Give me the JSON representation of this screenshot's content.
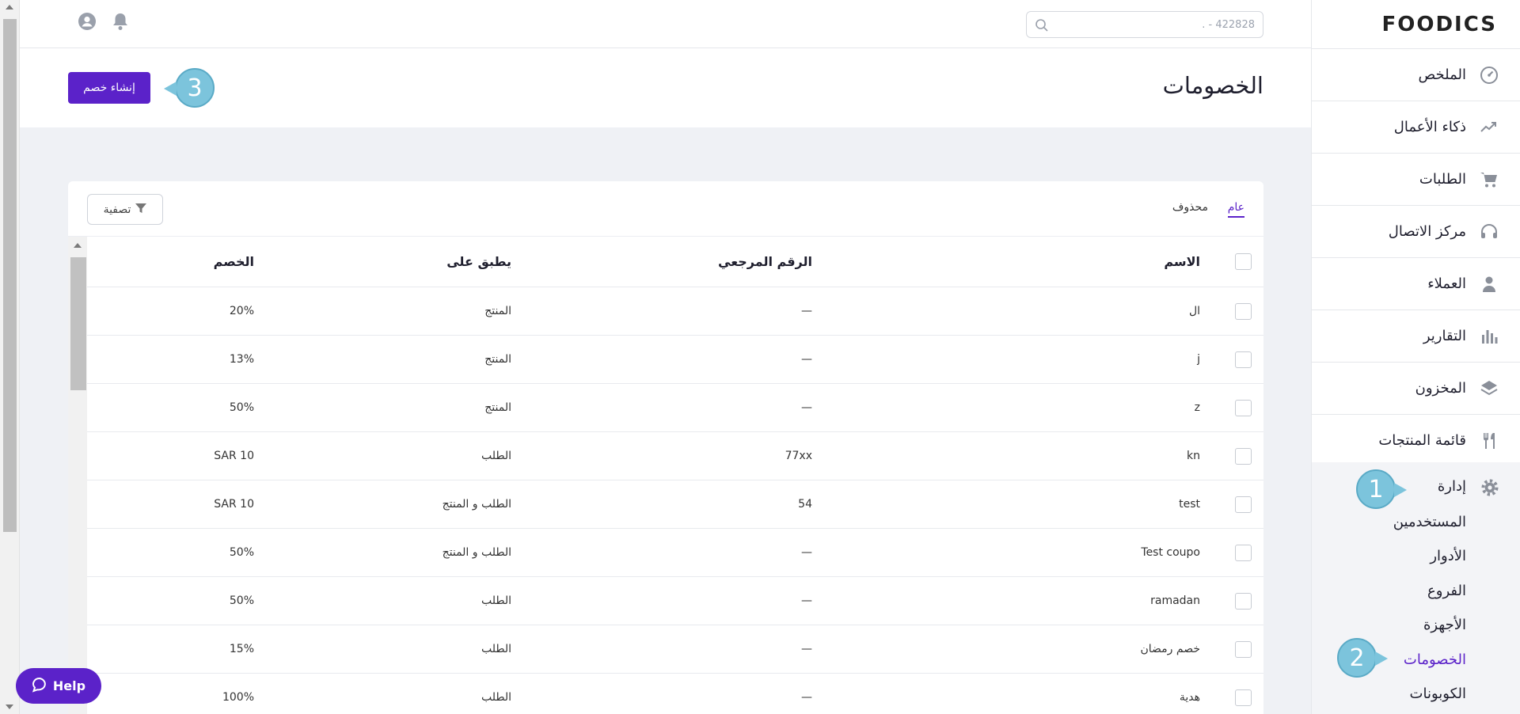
{
  "topbar": {
    "search_placeholder": "422828 - .",
    "icons": [
      "profile-icon",
      "bell-icon",
      "search-icon"
    ]
  },
  "header": {
    "title": "الخصومات",
    "create_button": "إنشاء خصم"
  },
  "tabs": {
    "general": "عام",
    "deleted": "محذوف",
    "filter": "تصفية"
  },
  "table": {
    "headers": {
      "name": "الاسم",
      "reference": "الرقم المرجعي",
      "applies_to": "يطبق على",
      "discount": "الخصم"
    },
    "rows": [
      {
        "name": "ال",
        "reference": "—",
        "applies_to": "المنتج",
        "discount": "20%"
      },
      {
        "name": "j",
        "reference": "—",
        "applies_to": "المنتج",
        "discount": "13%"
      },
      {
        "name": "z",
        "reference": "—",
        "applies_to": "المنتج",
        "discount": "50%"
      },
      {
        "name": "kn",
        "reference": "77xx",
        "applies_to": "الطلب",
        "discount": "SAR 10"
      },
      {
        "name": "test",
        "reference": "54",
        "applies_to": "الطلب و المنتج",
        "discount": "SAR 10"
      },
      {
        "name": "Test coupo",
        "reference": "—",
        "applies_to": "الطلب و المنتج",
        "discount": "50%"
      },
      {
        "name": "ramadan",
        "reference": "—",
        "applies_to": "الطلب",
        "discount": "50%"
      },
      {
        "name": "خصم رمضان",
        "reference": "—",
        "applies_to": "الطلب",
        "discount": "15%"
      },
      {
        "name": "هدية",
        "reference": "—",
        "applies_to": "الطلب",
        "discount": "100%"
      }
    ]
  },
  "sidebar": {
    "logo": "FOODICS",
    "items": [
      {
        "label": "الملخص",
        "icon": "dashboard-icon"
      },
      {
        "label": "ذكاء الأعمال",
        "icon": "chart-line-icon"
      },
      {
        "label": "الطلبات",
        "icon": "cart-icon"
      },
      {
        "label": "مركز الاتصال",
        "icon": "headset-icon"
      },
      {
        "label": "العملاء",
        "icon": "customers-icon"
      },
      {
        "label": "التقارير",
        "icon": "bar-chart-icon"
      },
      {
        "label": "المخزون",
        "icon": "layers-icon"
      },
      {
        "label": "قائمة المنتجات",
        "icon": "utensils-icon"
      }
    ],
    "admin": {
      "label": "إدارة",
      "icon": "gear-icon",
      "sub_items": [
        "المستخدمين",
        "الأدوار",
        "الفروع",
        "الأجهزة",
        "الخصومات",
        "الكوبونات"
      ],
      "active": "الخصومات"
    }
  },
  "annotations": [
    "1",
    "2",
    "3"
  ],
  "help": {
    "label": "Help"
  },
  "colors": {
    "accent": "#5b22c9",
    "bubble": "#7cc4dc",
    "background": "#eff1f5"
  }
}
